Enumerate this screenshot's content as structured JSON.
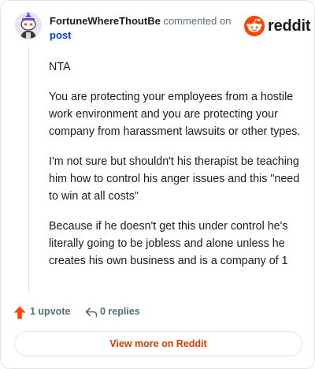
{
  "header": {
    "author": "FortuneWhereThoutBe",
    "action": "commented on",
    "post_link": "post",
    "brand": "reddit"
  },
  "comment": {
    "paragraphs": [
      "NTA",
      "You are protecting your employees from a hostile work environment and you are protecting your company from harassment lawsuits or other types.",
      "I'm not sure but shouldn't his therapist be teaching him how to control his anger issues and this \"need to win at all costs\"",
      "Because if he doesn't get this under control he's literally going to be jobless and alone unless he creates his own business and is a company of 1"
    ]
  },
  "footer": {
    "upvotes": "1 upvote",
    "replies": "0 replies",
    "view_more": "View more on Reddit"
  },
  "colors": {
    "brand_orange": "#ff4500",
    "link_blue": "#0045ac",
    "view_more_text": "#d93a00",
    "muted": "#576f76"
  },
  "icons": [
    "snoo-avatar-icon",
    "reddit-logo-icon",
    "upvote-arrow-icon",
    "reply-arrow-icon"
  ]
}
